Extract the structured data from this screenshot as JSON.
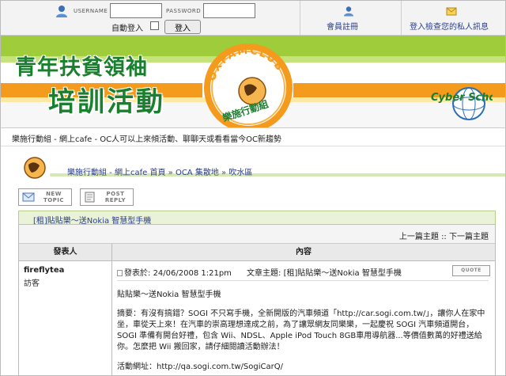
{
  "login": {
    "username_label": "USERNAME",
    "password_label": "PASSWORD",
    "username_value": "",
    "password_value": "",
    "auto_login_label": "自動登入",
    "login_button": "登入"
  },
  "header_links": {
    "register": "會員註冊",
    "messages": "登入檢查您的私人訊息"
  },
  "banner": {
    "title_line1": "青年扶貧領袖",
    "title_line2": "培訓活動",
    "oxfam_club": "OXFAMCLUB",
    "oxfam_group": "樂施行動組",
    "cyber_school": "Cyber School"
  },
  "slogan": "樂施行動組 - 網上cafe - OC人可以上來傾活動、聊聊天或看看當今OC新趨勢",
  "breadcrumb": {
    "items": [
      "樂施行動組 - 網上cafe 首頁",
      "OCA 集散地",
      "吹水區"
    ],
    "separator": "»"
  },
  "actions": {
    "new_topic": [
      "NEW",
      "TOPIC"
    ],
    "post_reply": [
      "POST",
      "REPLY"
    ]
  },
  "topic": {
    "title": "[租]貼貼樂～送Nokia 智慧型手機",
    "nav_prev": "上一篇主題",
    "nav_sep": "::",
    "nav_next": "下一篇主題"
  },
  "table": {
    "col_author": "發表人",
    "col_content": "內容"
  },
  "post": {
    "author": "fireflytea",
    "author_role": "訪客",
    "posted_label": "發表於:",
    "posted_date": "24/06/2008 1:21pm",
    "subject_label": "文章主題:",
    "subject": "[租]貼貼樂～送Nokia 智慧型手機",
    "quote_button": "QUOTE",
    "title": "貼貼樂～送Nokia 智慧型手機",
    "body": "摘要：有沒有搞錯？SOGI 不只寫手機，全新開版的汽車頻道「http://car.sogi.com.tw/」，讓你人在家中坐，車從天上來！在汽車的崇高理想達成之前，為了讓眾網友同樂樂，一起慶祝 SOGI 汽車頻道開台，SOGI 準備有開台好禮，包含 Wii、NDSL、Apple iPod Touch 8GB車用導航器...等價值數萬的好禮送給你。怎麼把 Wii 搬回家，請仔細閱讀活動辦法！",
    "link_label": "活動網址：",
    "link_url": "http://qa.sogi.com.tw/SogiCarQ/"
  }
}
